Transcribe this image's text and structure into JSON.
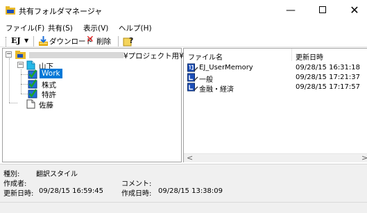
{
  "window": {
    "title": "共有フォルダマネージャ",
    "minimize_glyph": "—",
    "close_glyph": "✕"
  },
  "menu": {
    "items": [
      {
        "label": "ファイル(F)"
      },
      {
        "label": "共有(S)"
      },
      {
        "label": "表示(V)"
      },
      {
        "label": "ヘルプ(H)"
      }
    ]
  },
  "toolbar": {
    "ej_label": "EJ",
    "dropdown_glyph": "▼",
    "download_label": "ダウンロード",
    "delete_glyph": "✕",
    "delete_label": "削除"
  },
  "tree": {
    "root_suffix": "¥プロジェクト用¥",
    "nodes": [
      {
        "label": "山下"
      },
      {
        "label": "Work"
      },
      {
        "label": "株式"
      },
      {
        "label": "特許"
      },
      {
        "label": "佐藤"
      }
    ]
  },
  "list": {
    "columns": [
      {
        "label": "ファイル名"
      },
      {
        "label": "更新日時"
      }
    ],
    "rows": [
      {
        "name": "EJ_UserMemory",
        "date": "09/28/15 16:31:18",
        "icon": "user-memory-icon"
      },
      {
        "name": "一般",
        "date": "09/28/15 17:21:37",
        "icon": "dictionary-icon"
      },
      {
        "name": "金融・経済",
        "date": "09/28/15 17:17:57",
        "icon": "dictionary-icon"
      }
    ],
    "scroll_left": "<",
    "scroll_right": ">"
  },
  "info": {
    "type_label": "種別:",
    "type_value": "翻訳スタイル",
    "author_label": "作成者:",
    "comment_label": "コメント:",
    "updated_label": "更新日時:",
    "updated_value": "09/28/15 16:59:45",
    "created_label": "作成日時:",
    "created_value": "09/28/15 13:38:09"
  },
  "colors": {
    "selection": "#0078d7",
    "folder_yellow": "#e8b92a",
    "folder_cyan": "#25b8e8",
    "check_green": "#1aa32a",
    "delete_red": "#e21b1b"
  }
}
